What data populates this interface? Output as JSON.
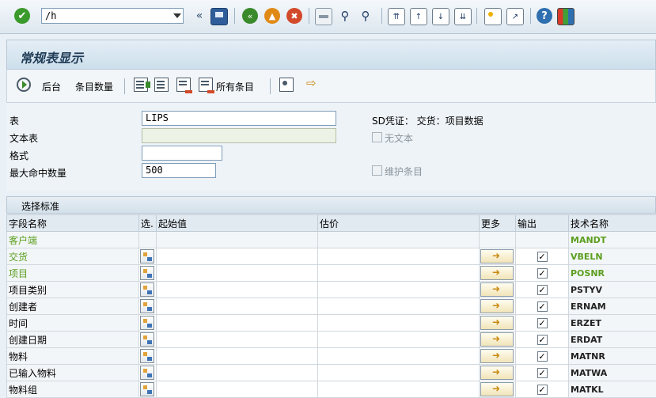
{
  "toolbar": {
    "command_value": "/h",
    "icons": [
      "enter-icon",
      "nav-back-icon",
      "save-icon",
      "back-icon",
      "exit-icon",
      "cancel-icon",
      "print-icon",
      "find-icon",
      "find-next-icon",
      "first-page-icon",
      "prev-page-icon",
      "next-page-icon",
      "last-page-icon",
      "new-session-icon",
      "shortcut-icon",
      "help-icon",
      "layout-icon"
    ],
    "colors": {
      "back": "#3a8a2c",
      "exit": "#e08a16",
      "cancel": "#d24a2a",
      "enter": "#3a9a2c"
    }
  },
  "title": "常规表显示",
  "app_toolbar": {
    "background_label": "后台",
    "entries_label": "条目数量",
    "all_entries_label": "所有条目"
  },
  "form": {
    "table_label": "表",
    "table_value": "LIPS",
    "text_table_label": "文本表",
    "text_table_value": "",
    "format_label": "格式",
    "format_value": "",
    "max_hits_label": "最大命中数量",
    "max_hits_value": "500",
    "description": "SD凭证： 交货：项目数据",
    "no_text_label": "无文本",
    "maintain_entries_label": "维护条目"
  },
  "section_title": "选择标准",
  "grid": {
    "headers": {
      "field": "字段名称",
      "select": "选.",
      "from": "起始值",
      "to": "估价",
      "more": "更多",
      "output": "输出",
      "tech": "技术名称"
    },
    "rows": [
      {
        "field": "客户端",
        "tech": "MANDT",
        "key": true,
        "has_select": false,
        "output": false
      },
      {
        "field": "交货",
        "tech": "VBELN",
        "key": true,
        "has_select": true,
        "output": true
      },
      {
        "field": "项目",
        "tech": "POSNR",
        "key": true,
        "has_select": true,
        "output": true
      },
      {
        "field": "项目类别",
        "tech": "PSTYV",
        "key": false,
        "has_select": true,
        "output": true
      },
      {
        "field": "创建者",
        "tech": "ERNAM",
        "key": false,
        "has_select": true,
        "output": true
      },
      {
        "field": "时间",
        "tech": "ERZET",
        "key": false,
        "has_select": true,
        "output": true
      },
      {
        "field": "创建日期",
        "tech": "ERDAT",
        "key": false,
        "has_select": true,
        "output": true
      },
      {
        "field": "物料",
        "tech": "MATNR",
        "key": false,
        "has_select": true,
        "output": true
      },
      {
        "field": "已输入物料",
        "tech": "MATWA",
        "key": false,
        "has_select": true,
        "output": true
      },
      {
        "field": "物料组",
        "tech": "MATKL",
        "key": false,
        "has_select": true,
        "output": true
      }
    ]
  }
}
